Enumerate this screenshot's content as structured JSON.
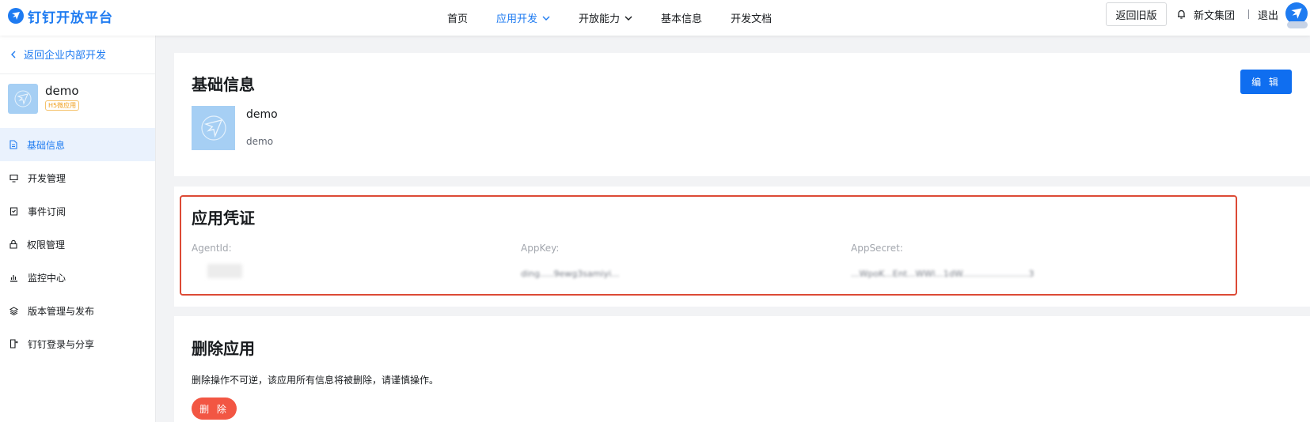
{
  "header": {
    "logo_text": "钉钉开放平台",
    "nav": [
      {
        "label": "首页"
      },
      {
        "label": "应用开发"
      },
      {
        "label": "开放能力"
      },
      {
        "label": "基本信息"
      },
      {
        "label": "开发文档"
      }
    ],
    "old_version_label": "返回旧版",
    "org_name": "新文集团",
    "logout_label": "退出"
  },
  "sidebar": {
    "back_label": "返回企业内部开发",
    "app_name": "demo",
    "app_badge": "H5微应用",
    "menu": [
      {
        "label": "基础信息",
        "icon": "document-icon"
      },
      {
        "label": "开发管理",
        "icon": "monitor-icon"
      },
      {
        "label": "事件订阅",
        "icon": "subscription-icon"
      },
      {
        "label": "权限管理",
        "icon": "lock-icon"
      },
      {
        "label": "监控中心",
        "icon": "bar-chart-icon"
      },
      {
        "label": "版本管理与发布",
        "icon": "layers-icon"
      },
      {
        "label": "钉钉登录与分享",
        "icon": "share-icon"
      }
    ]
  },
  "basic_info": {
    "title": "基础信息",
    "edit_label": "编 辑",
    "app_name": "demo",
    "app_desc": "demo"
  },
  "credentials": {
    "title": "应用凭证",
    "agent_id_label": "AgentId:",
    "app_key_label": "AppKey:",
    "app_secret_label": "AppSecret:",
    "app_key_value": "ding.....9ewg3samiyi...",
    "app_secret_value": "...WpoK...Ent...WWl...1dW........................3"
  },
  "delete_app": {
    "title": "删除应用",
    "description": "删除操作不可逆，该应用所有信息将被删除，请谨慎操作。",
    "button_label": "删 除"
  },
  "colors": {
    "primary": "#1e7bf1",
    "danger": "#f25643",
    "highlight_border": "#dc4a35"
  }
}
